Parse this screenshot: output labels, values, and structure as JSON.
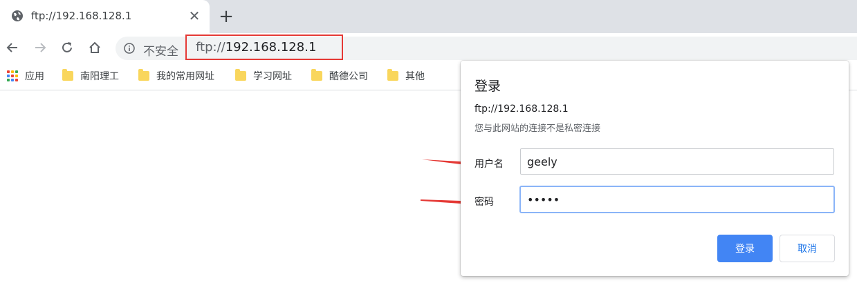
{
  "tab": {
    "title": "ftp://192.168.128.1"
  },
  "toolbar": {
    "security_text": "不安全",
    "url_scheme": "ftp://",
    "url_host": "192.168.128.1"
  },
  "bookmarks": {
    "items": [
      {
        "label": "应用",
        "icon": "apps-icon"
      },
      {
        "label": "南阳理工",
        "icon": "folder-icon"
      },
      {
        "label": "我的常用网址",
        "icon": "folder-icon"
      },
      {
        "label": "学习网址",
        "icon": "folder-icon"
      },
      {
        "label": "酷德公司",
        "icon": "folder-icon"
      },
      {
        "label": "其他",
        "icon": "folder-icon"
      }
    ]
  },
  "dialog": {
    "title": "登录",
    "host": "ftp://192.168.128.1",
    "warning": "您与此网站的连接不是私密连接",
    "username_label": "用户名",
    "username_value": "geely",
    "password_label": "密码",
    "password_value": "•••••",
    "login_label": "登录",
    "cancel_label": "取消"
  },
  "colors": {
    "highlight_border": "#e53935",
    "annotation_arrow": "#e53935",
    "primary_button": "#4285f4"
  }
}
